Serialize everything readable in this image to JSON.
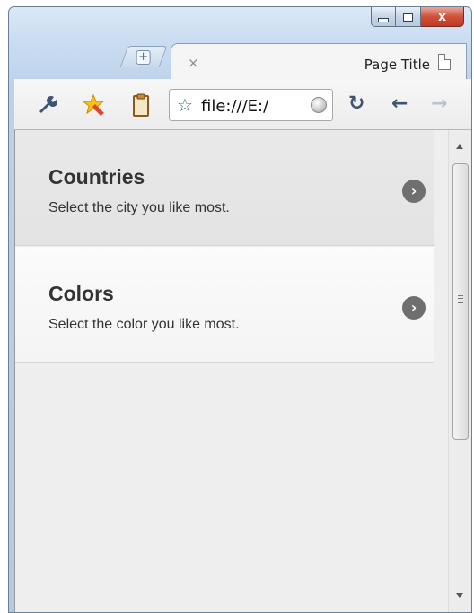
{
  "window": {
    "controls": {
      "minimize": "minimize",
      "maximize": "maximize",
      "close": "x"
    }
  },
  "tabs": [
    {
      "title": "Page Title",
      "close": "×"
    }
  ],
  "new_tab": {
    "label": "+"
  },
  "toolbar": {
    "address": "file:///E:/",
    "buttons": [
      "wrench-icon",
      "extension-star-icon",
      "clipboard-icon",
      "reload-icon",
      "back-icon",
      "forward-icon"
    ]
  },
  "list": {
    "items": [
      {
        "title": "Countries",
        "description": "Select the city you like most."
      },
      {
        "title": "Colors",
        "description": "Select the color you like most."
      }
    ]
  },
  "colors": {
    "chevron": "#6f6f6f",
    "text": "#333333",
    "background": "#eeeeee"
  }
}
